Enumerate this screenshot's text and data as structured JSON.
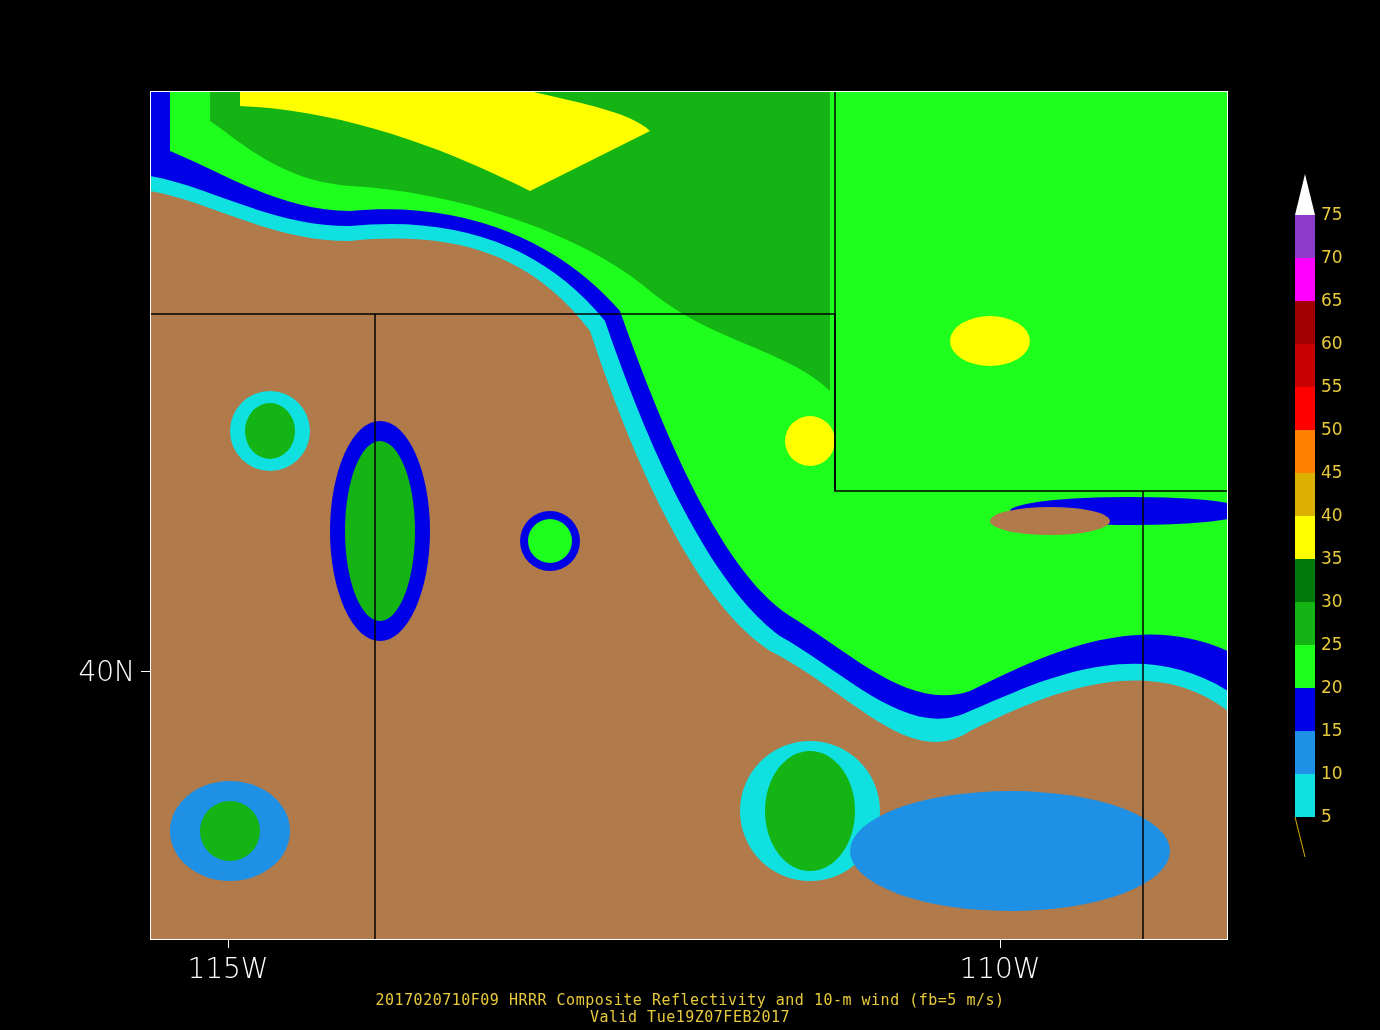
{
  "plot": {
    "x_axis_labels": [
      "115W",
      "110W"
    ],
    "y_axis_labels": [
      "40N"
    ],
    "title": "2017020710F09 HRRR Composite Reflectivity and 10-m wind (fb=5 m/s)",
    "subtitle": "Valid Tue19Z07FEB2017"
  },
  "colorbar": {
    "labels": [
      "75",
      "70",
      "65",
      "60",
      "55",
      "50",
      "45",
      "40",
      "35",
      "30",
      "25",
      "20",
      "15",
      "10",
      "5"
    ],
    "segments": [
      {
        "color": "#8c3cc8"
      },
      {
        "color": "#ff00ff"
      },
      {
        "color": "#a00000"
      },
      {
        "color": "#c80000"
      },
      {
        "color": "#ff0000"
      },
      {
        "color": "#ff8000"
      },
      {
        "color": "#dcb000"
      },
      {
        "color": "#ffff00"
      },
      {
        "color": "#00780a"
      },
      {
        "color": "#14b414"
      },
      {
        "color": "#1eff1e"
      },
      {
        "color": "#0000e6"
      },
      {
        "color": "#1e90e6"
      },
      {
        "color": "#10e0e0"
      }
    ]
  }
}
